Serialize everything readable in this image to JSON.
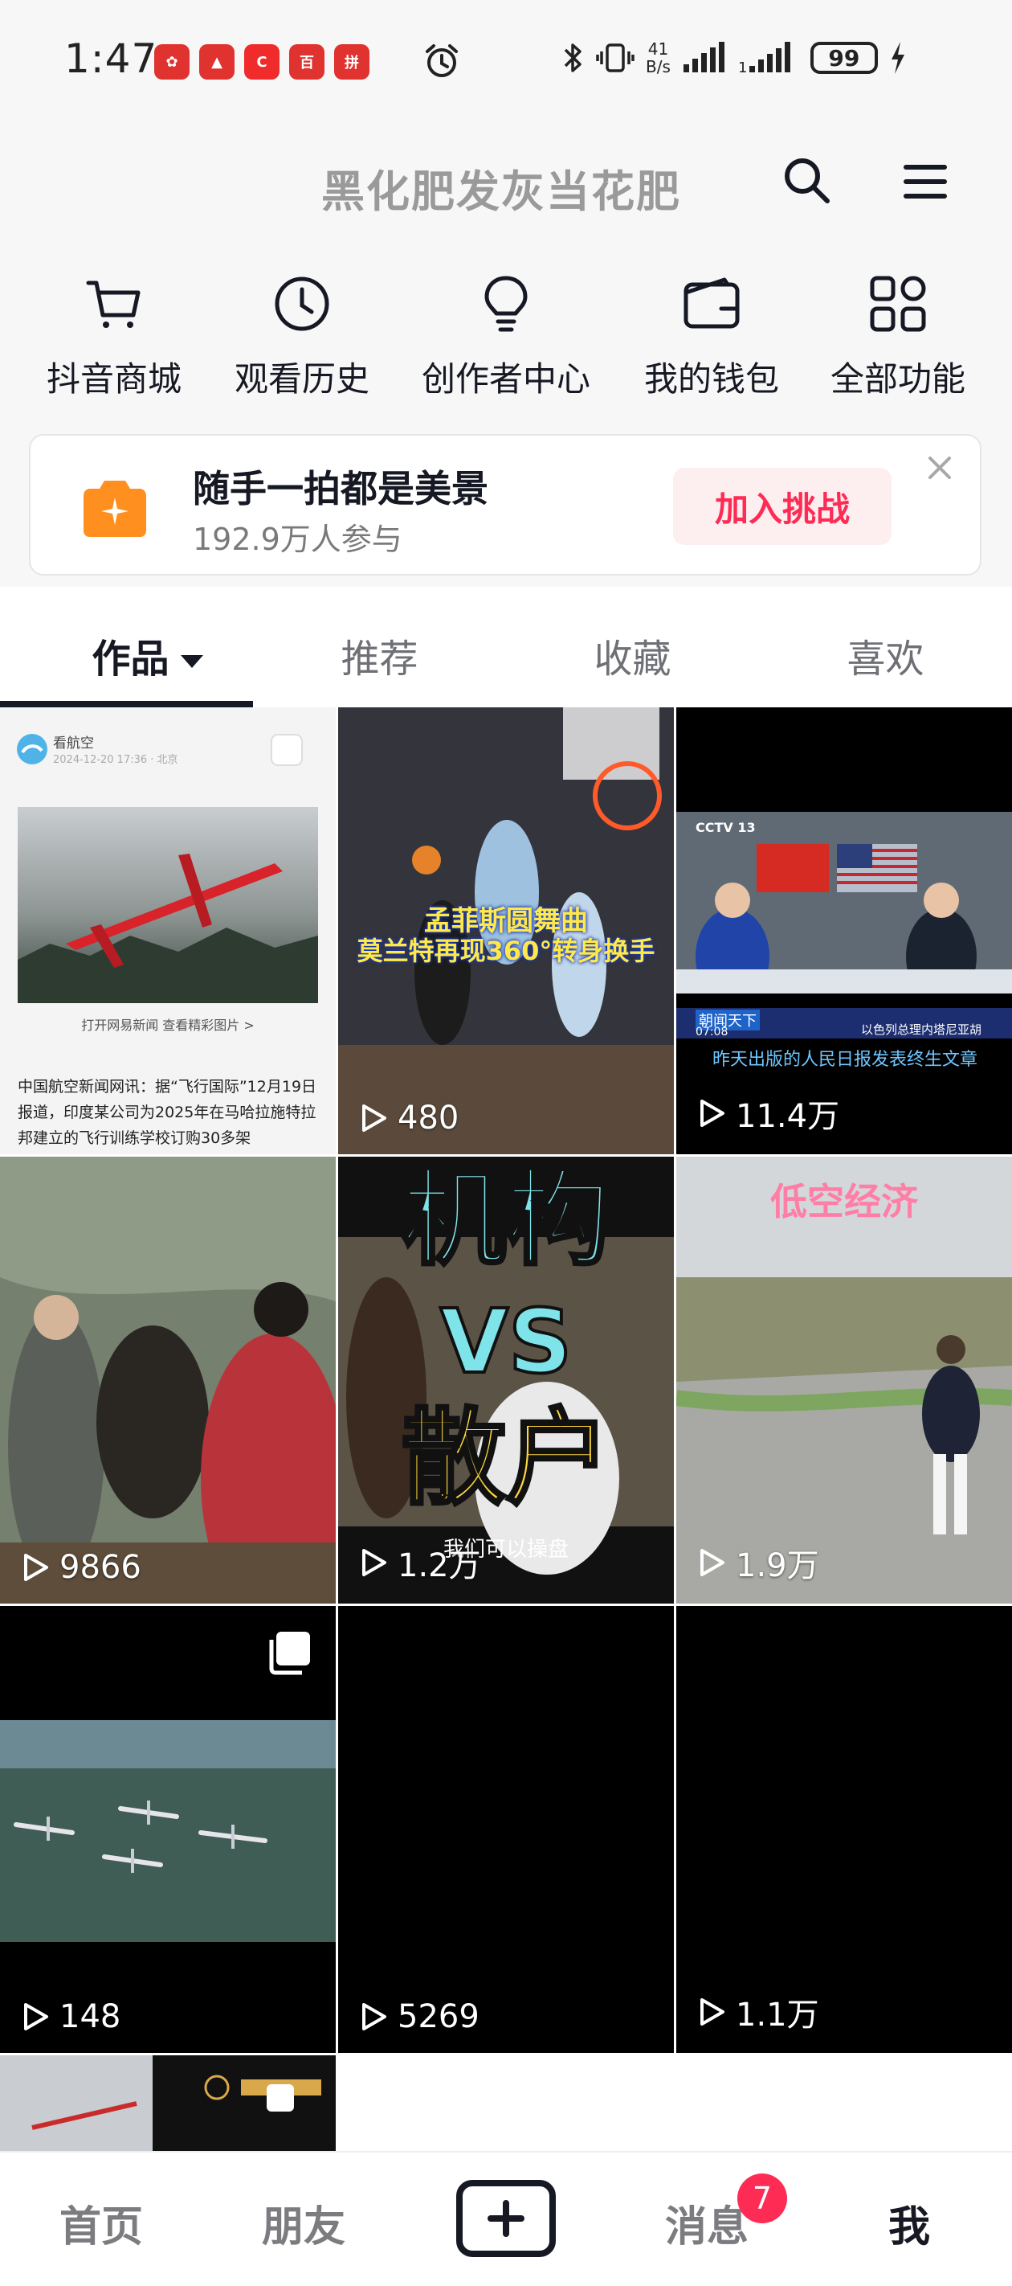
{
  "status_bar": {
    "time": "1:47",
    "app_badges": [
      {
        "label": "✿",
        "color": "#e0322f"
      },
      {
        "label": "▲",
        "color": "#e0322f"
      },
      {
        "label": "C",
        "color": "#f02b2b"
      },
      {
        "label": "百",
        "color": "#e0322f"
      },
      {
        "label": "拼",
        "color": "#e0322f"
      }
    ],
    "net_speed_value": "41",
    "net_speed_unit": "B/s",
    "battery": "99"
  },
  "header": {
    "search_hint": "黑化肥发灰当花肥"
  },
  "quick_functions": [
    {
      "label": "抖音商城",
      "icon": "cart-icon"
    },
    {
      "label": "观看历史",
      "icon": "clock-icon"
    },
    {
      "label": "创作者中心",
      "icon": "lightbulb-icon"
    },
    {
      "label": "我的钱包",
      "icon": "wallet-icon"
    },
    {
      "label": "全部功能",
      "icon": "grid-icon"
    }
  ],
  "challenge": {
    "title": "随手一拍都是美景",
    "participants": "192.9万人参与",
    "join_label": "加入挑战"
  },
  "tabs": [
    {
      "label": "作品",
      "active": true
    },
    {
      "label": "推荐",
      "active": false
    },
    {
      "label": "收藏",
      "active": false
    },
    {
      "label": "喜欢",
      "active": false
    }
  ],
  "grid": {
    "cells": [
      {
        "kind": "article",
        "source": "看航空",
        "meta": "2024-12-20 17:36 · 北京",
        "link_text": "打开网易新闻 查看精彩图片 >",
        "body": "中国航空新闻网讯：据“飞行国际”12月19日报道，印度某公司为2025年在马哈拉施特拉邦建立的飞行训练学校订购30多架",
        "plays": ""
      },
      {
        "kind": "video",
        "caption_line1": "孟菲斯圆舞曲",
        "caption_line2": "莫兰特再现360°转身换手",
        "plays": "480"
      },
      {
        "kind": "video",
        "channel": "CCTV 13",
        "ticker_label": "朝闻天下",
        "ticker_time": "07:08",
        "ticker_text": "以色列总理内塔尼亚胡",
        "subtitle": "昨天出版的人民日报发表终生文章",
        "plays": "11.4万"
      },
      {
        "kind": "video",
        "plays": "9866"
      },
      {
        "kind": "video",
        "big_text_1": "机构",
        "big_text_2": "VS",
        "big_text_3": "散户",
        "small_caption": "我们可以操盘",
        "plays": "1.2万"
      },
      {
        "kind": "video",
        "overlay_title": "低空经济",
        "plays": "1.9万"
      },
      {
        "kind": "video",
        "plays": "148",
        "multi": true
      },
      {
        "kind": "video",
        "plays": "5269"
      },
      {
        "kind": "video",
        "plays": "1.1万"
      },
      {
        "kind": "video",
        "plays": ""
      }
    ]
  },
  "bottom_nav": {
    "home": "首页",
    "friends": "朋友",
    "messages": "消息",
    "messages_badge": "7",
    "me": "我"
  },
  "colors": {
    "accent": "#fe2c55",
    "text_primary": "#161823",
    "text_secondary": "#7a7a7a"
  }
}
